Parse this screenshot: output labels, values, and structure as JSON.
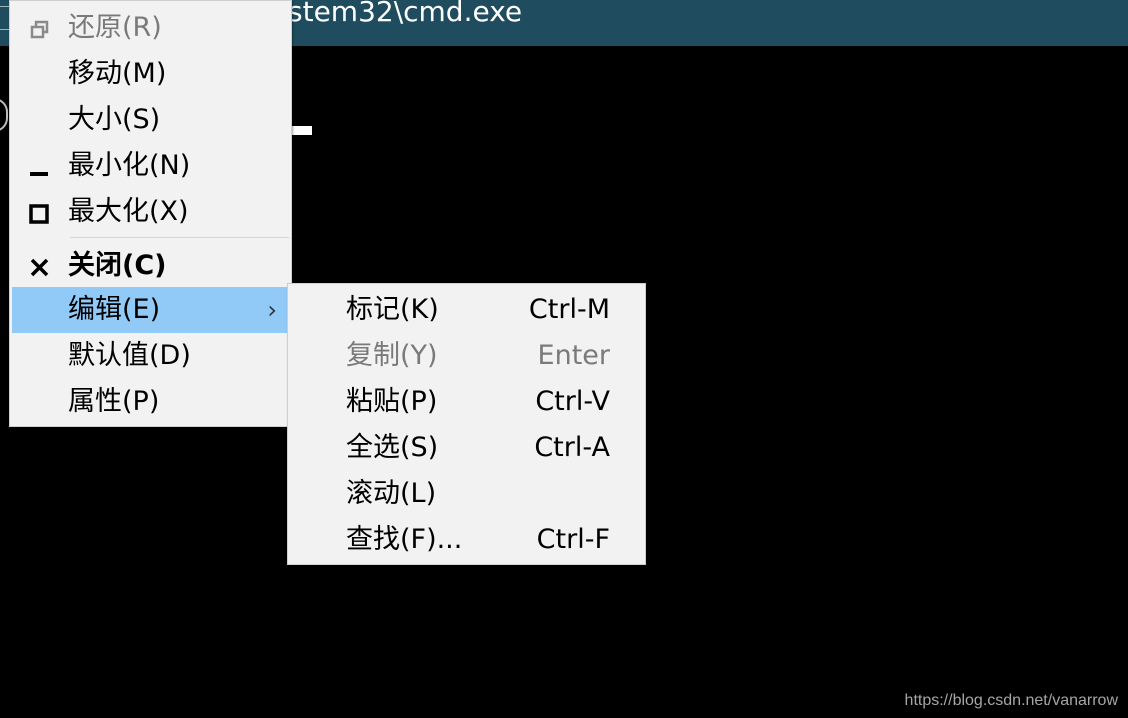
{
  "window": {
    "title_visible": "stem32\\cmd.exe"
  },
  "system_menu": {
    "items": [
      {
        "label": "还原(R)",
        "icon": "restore-icon",
        "disabled": true
      },
      {
        "label": "移动(M)"
      },
      {
        "label": "大小(S)"
      },
      {
        "label": "最小化(N)",
        "icon": "minimize-icon"
      },
      {
        "label": "最大化(X)",
        "icon": "maximize-icon"
      },
      {
        "label": "关闭(C)",
        "icon": "close-icon",
        "bold": true
      },
      {
        "label": "编辑(E)",
        "highlighted": true,
        "submenu_arrow": "›"
      },
      {
        "label": "默认值(D)"
      },
      {
        "label": "属性(P)"
      }
    ]
  },
  "edit_submenu": {
    "items": [
      {
        "label": "标记(K)",
        "shortcut": "Ctrl-M"
      },
      {
        "label": "复制(Y)",
        "shortcut": "Enter",
        "disabled": true
      },
      {
        "label": "粘贴(P)",
        "shortcut": "Ctrl-V"
      },
      {
        "label": "全选(S)",
        "shortcut": "Ctrl-A"
      },
      {
        "label": "滚动(L)",
        "shortcut": ""
      },
      {
        "label": "查找(F)...",
        "shortcut": "Ctrl-F"
      }
    ]
  },
  "watermark": "https://blog.csdn.net/vanarrow",
  "colors": {
    "titlebar": "#1f4c5e",
    "console_bg": "#000000",
    "menu_bg": "#f2f2f2",
    "highlight": "#91c9f7",
    "disabled_text": "#7a7a7a"
  }
}
